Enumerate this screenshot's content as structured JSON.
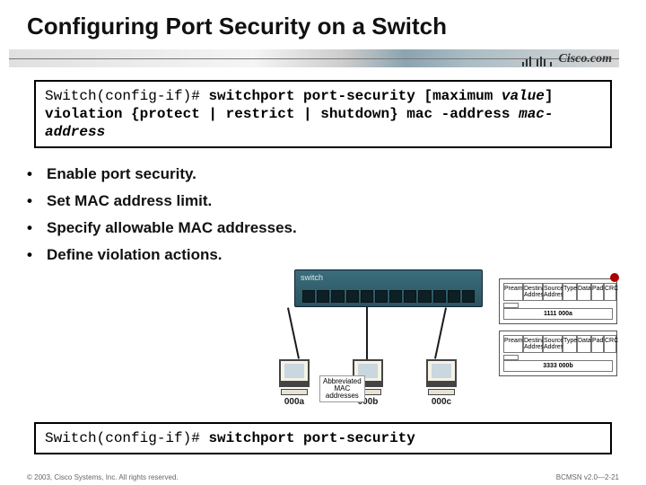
{
  "title": "Configuring Port Security on a Switch",
  "brand": "Cisco.com",
  "cmd_top": {
    "prompt": "Switch(config-if)# ",
    "kw1": "switchport port-security [maximum ",
    "arg1": "value",
    "kw2": "] violation {protect | restrict | shutdown} mac -address ",
    "arg2": "mac-address"
  },
  "bullets": [
    "Enable port security.",
    "Set MAC address limit.",
    "Specify allowable MAC addresses.",
    "Define violation actions."
  ],
  "diagram": {
    "switch_label": "switch",
    "pcs": [
      "000a",
      "000b",
      "000c"
    ],
    "mac_note": "Abbreviated\nMAC\naddresses"
  },
  "frame": {
    "headers": [
      "Preamble",
      "Destination Address",
      "Source Address",
      "Type",
      "Data",
      "Pad",
      "CRC"
    ],
    "row1_value": "1111  000a",
    "row2_value": "3333  000b"
  },
  "cmd_bottom": {
    "prompt": "Switch(config-if)# ",
    "kw": "switchport port-security"
  },
  "footer": {
    "left": "© 2003, Cisco Systems, Inc. All rights reserved.",
    "right": "BCMSN v2.0—2-21"
  }
}
